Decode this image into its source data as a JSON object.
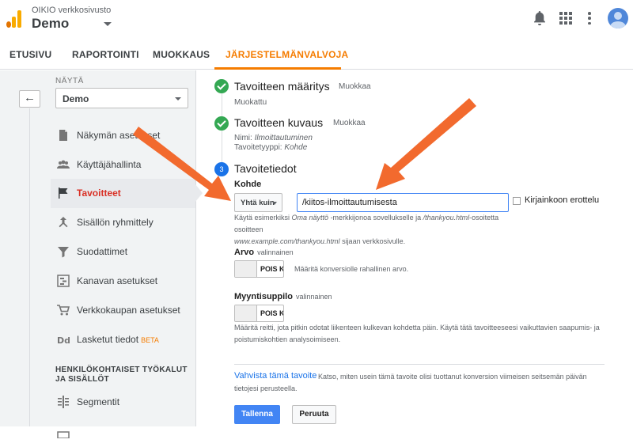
{
  "header": {
    "account_line": "OIKIO verkkosivusto",
    "property_name": "Demo"
  },
  "nav": {
    "tabs": [
      {
        "label": "ETUSIVU"
      },
      {
        "label": "RAPORTOINTI"
      },
      {
        "label": "MUOKKAUS"
      },
      {
        "label": "JÄRJESTELMÄNVALVOJA",
        "active": true
      }
    ]
  },
  "sidebar": {
    "back_icon": "←",
    "view_label": "NÄYTÄ",
    "view_value": "Demo",
    "items": [
      {
        "label": "Näkymän asetukset",
        "icon": "document-icon"
      },
      {
        "label": "Käyttäjähallinta",
        "icon": "users-icon"
      },
      {
        "label": "Tavoitteet",
        "icon": "flag-icon",
        "active": true
      },
      {
        "label": "Sisällön ryhmittely",
        "icon": "grouping-icon"
      },
      {
        "label": "Suodattimet",
        "icon": "filter-icon"
      },
      {
        "label": "Kanavan asetukset",
        "icon": "channel-icon"
      },
      {
        "label": "Verkkokaupan asetukset",
        "icon": "cart-icon"
      },
      {
        "label": "Lasketut tiedot",
        "icon": "dd-icon",
        "badge": "BETA"
      }
    ],
    "section_title": "HENKILÖKOHTAISET TYÖKALUT JA SISÄLLÖT",
    "section_items": [
      {
        "label": "Segmentit",
        "icon": "segments-icon"
      }
    ]
  },
  "steps": {
    "step1": {
      "title": "Tavoitteen määritys",
      "edit": "Muokkaa",
      "sub": "Muokattu"
    },
    "step2": {
      "title": "Tavoitteen kuvaus",
      "edit": "Muokkaa",
      "name_label": "Nimi: ",
      "name_value": "Ilmoittautuminen",
      "type_label": "Tavoitetyyppi: ",
      "type_value": "Kohde"
    },
    "step3": {
      "number": "3",
      "title": "Tavoitetiedot"
    }
  },
  "destination": {
    "label": "Kohde",
    "match_type": "Yhtä kuin",
    "value": "/kiitos-ilmoittautumisesta",
    "case_sensitive_label": "Kirjainkoon erottelu",
    "help_a": "Käytä esimerkiksi ",
    "help_b": "Oma näyttö",
    "help_c": " -merkkijonoa sovellukselle ja ",
    "help_d": "/thankyou.html",
    "help_e": "-osoitetta osoitteen",
    "help_f": "www.example.com/thankyou.html",
    "help_g": " sijaan verkkosivulle."
  },
  "value_field": {
    "label": "Arvo",
    "optional": "valinnainen",
    "toggle": "POIS KÄYTÖSTÄ",
    "help": "Määritä konversiolle rahallinen arvo."
  },
  "funnel_field": {
    "label": "Myyntisuppilo",
    "optional": "valinnainen",
    "toggle": "POIS KÄYTÖSTÄ",
    "help": "Määritä reitti, jota pitkin odotat liikenteen kulkevan kohdetta päin. Käytä tätä tavoitteeseesi vaikuttavien saapumis- ja poistumiskohtien analysoimiseen."
  },
  "verify": {
    "link": "Vahvista tämä tavoite",
    "help": "Katso, miten usein tämä tavoite olisi tuottanut konversion viimeisen seitsemän päivän tietojesi perusteella."
  },
  "actions": {
    "save": "Tallenna",
    "cancel": "Peruuta"
  },
  "colors": {
    "accent": "#f57c00",
    "primary_button": "#4285f4",
    "success": "#34a853",
    "annotation_arrow": "#f26a2e"
  }
}
